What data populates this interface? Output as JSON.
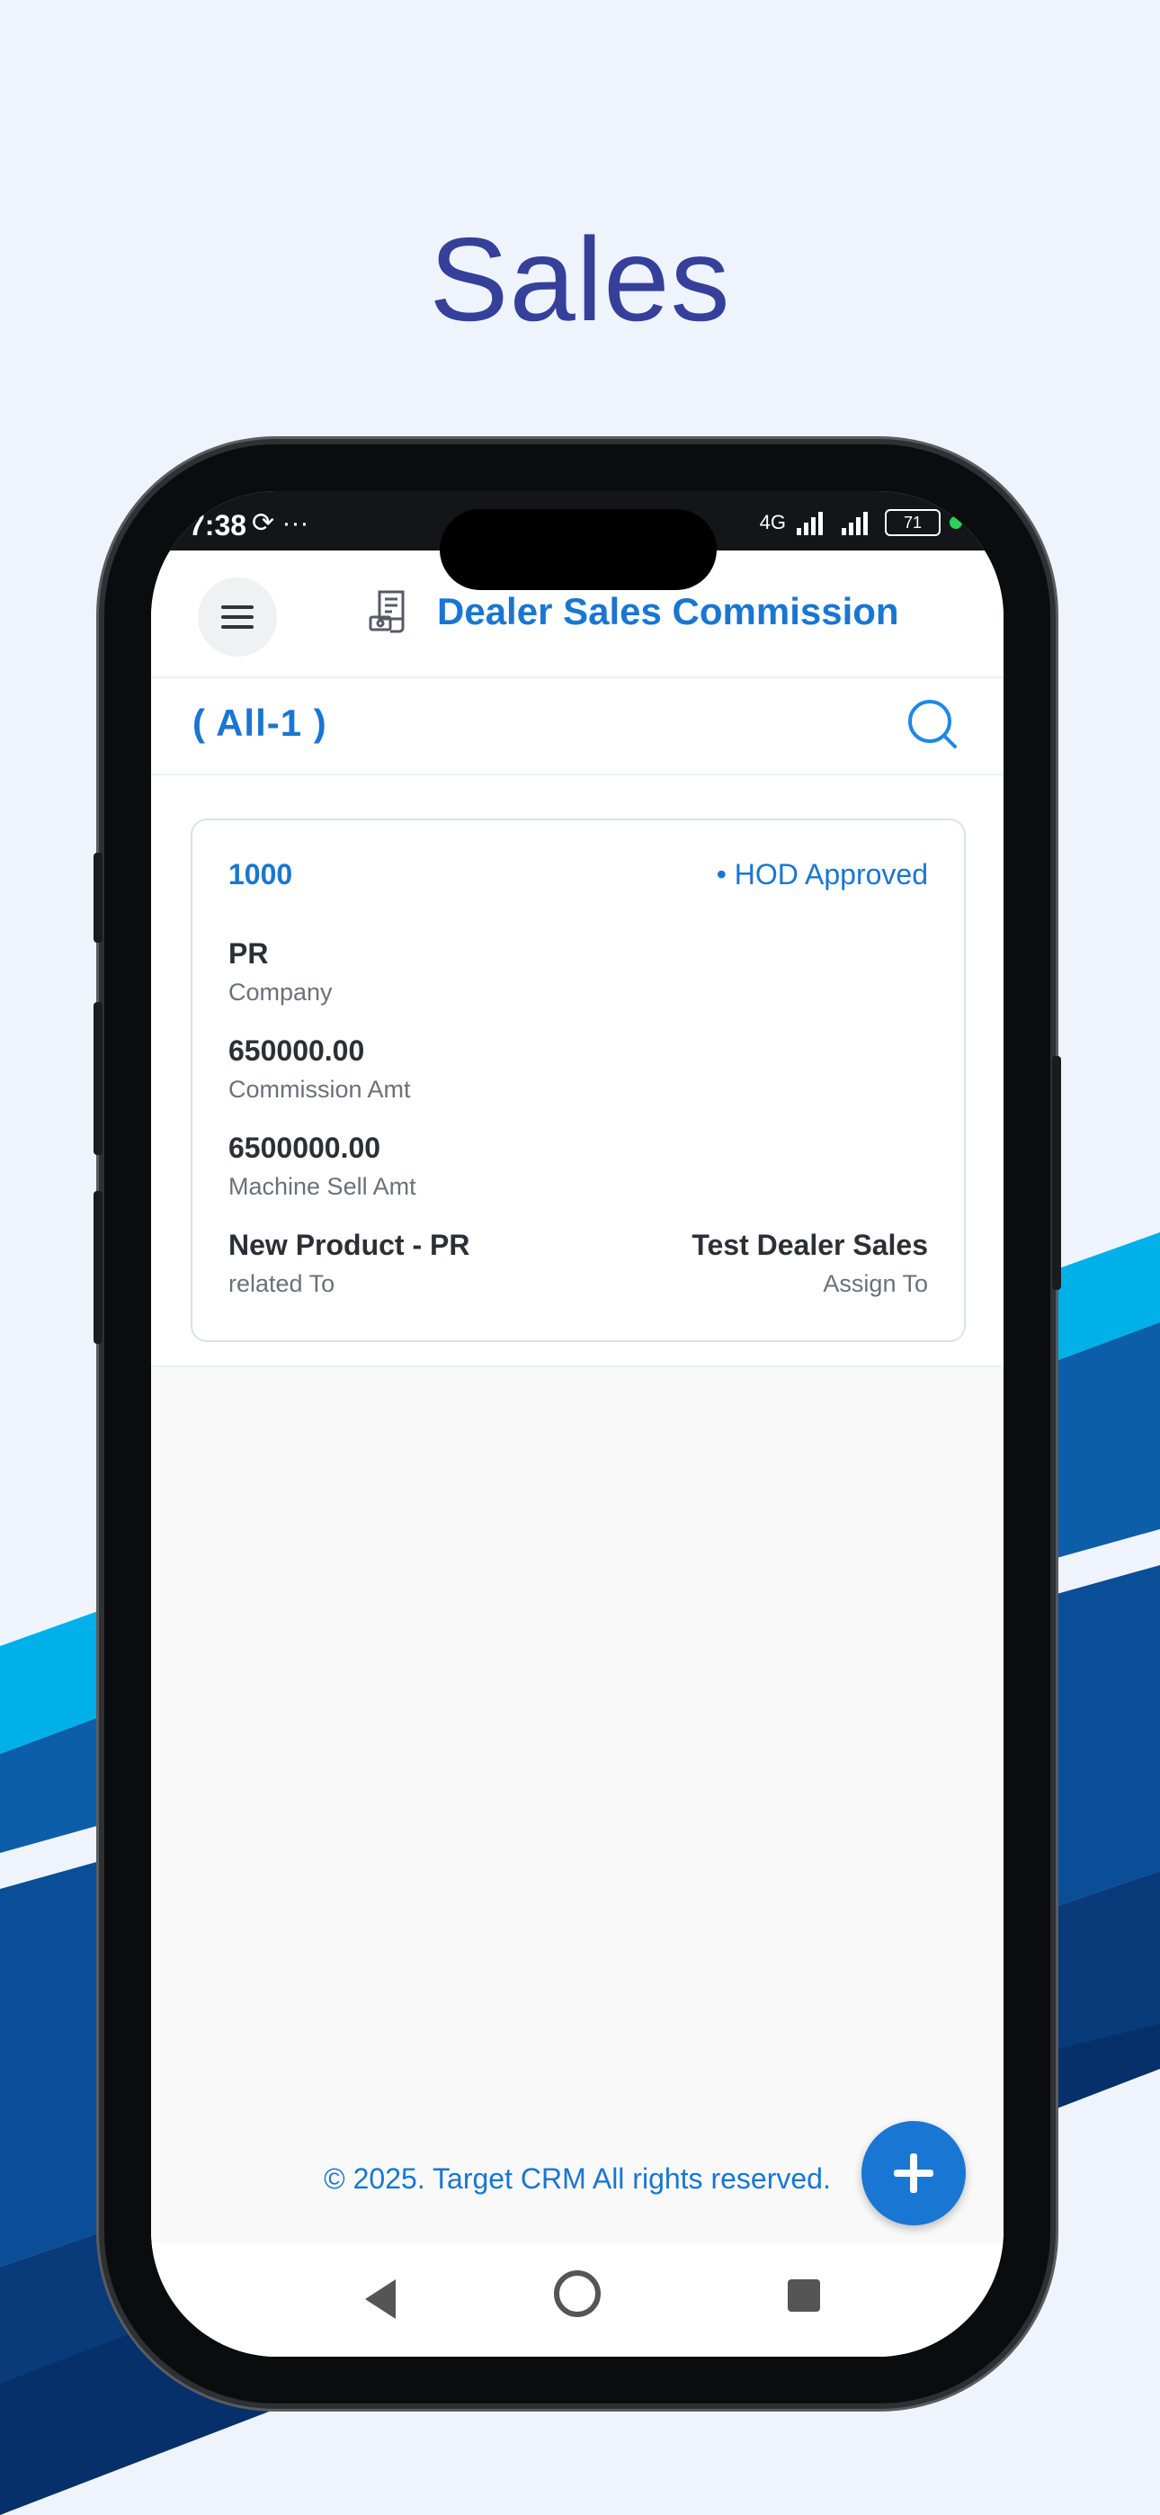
{
  "page": {
    "headline": "Sales"
  },
  "status_bar": {
    "time": "7:38",
    "extra_icons": "⟳ ···",
    "network": "4G",
    "battery": "71"
  },
  "app_bar": {
    "title": "Dealer Sales Commission",
    "menu_icon": "hamburger-icon",
    "title_icon": "commission-doc-icon"
  },
  "filter": {
    "label": "( All-1 )",
    "search_icon": "search-icon"
  },
  "records": [
    {
      "id": "1000",
      "status": "• HOD Approved",
      "company": "PR",
      "company_label": "Company",
      "commission_amt": "650000.00",
      "commission_amt_label": "Commission Amt",
      "machine_sell_amt": "6500000.00",
      "machine_sell_amt_label": "Machine Sell Amt",
      "related_to": "New Product - PR",
      "related_to_label": "related To",
      "assign_to": "Test Dealer Sales",
      "assign_to_label": "Assign To"
    }
  ],
  "footer": {
    "copyright": "© 2025. Target CRM All rights reserved."
  },
  "fab": {
    "icon": "plus-icon"
  },
  "colors": {
    "brand": "#1976d2",
    "headline": "#34409a",
    "page_bg": "#eff4fc"
  }
}
